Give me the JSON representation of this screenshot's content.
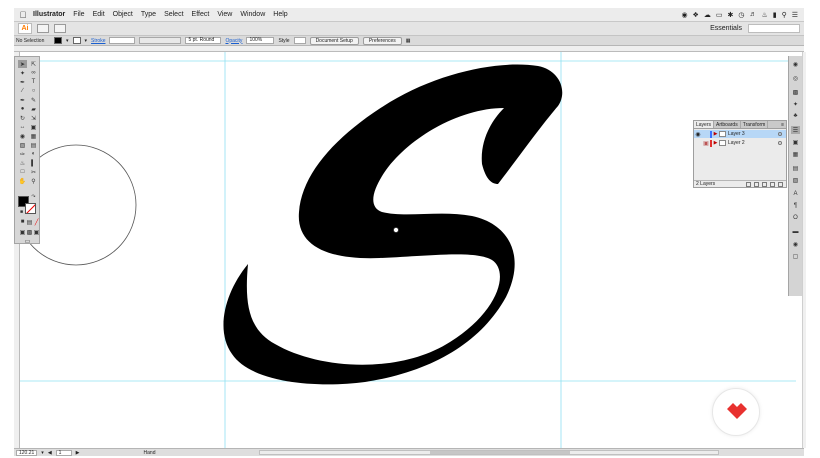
{
  "menubar": {
    "app_name": "Illustrator",
    "items": [
      "File",
      "Edit",
      "Object",
      "Type",
      "Select",
      "Effect",
      "View",
      "Window",
      "Help"
    ]
  },
  "appbar": {
    "logo": "Ai",
    "workspace": "Essentials"
  },
  "control_bar": {
    "selection": "No Selection",
    "stroke_label": "Stroke",
    "brush": "5 pt. Round",
    "opacity_label": "Opacity",
    "opacity_value": "100%",
    "style_label": "Style",
    "doc_setup": "Document Setup",
    "preferences": "Preferences"
  },
  "layers_panel": {
    "tabs": [
      "Layers",
      "Artboards",
      "Transform"
    ],
    "menu": "≡",
    "layers": [
      {
        "name": "Layer 3",
        "color": "#3a70ff",
        "selected": true
      },
      {
        "name": "Layer 2",
        "color": "#e0302e",
        "selected": false
      }
    ],
    "footer": "2 Layers"
  },
  "status_bar": {
    "zoom": "120.21",
    "page": "1",
    "tool": "Hand"
  },
  "colors": {
    "guide": "#8fe0f2",
    "accent_red": "#e8312f",
    "selection_blue": "#b7d7f6"
  }
}
